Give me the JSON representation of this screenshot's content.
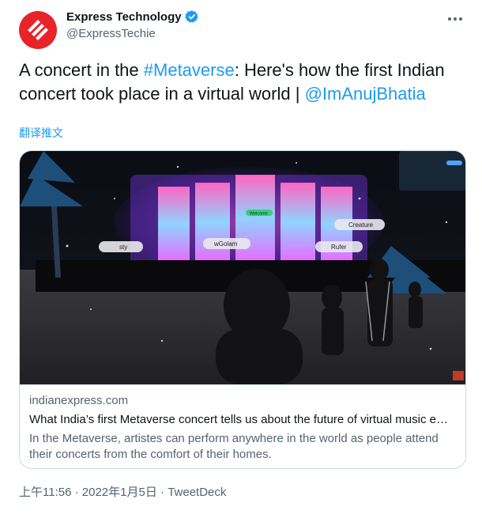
{
  "author": {
    "display_name": "Express Technology",
    "handle": "@ExpressTechie"
  },
  "tweet": {
    "text_prefix": "A concert in the ",
    "hashtag": "#Metaverse",
    "text_middle": ":  Here's how the first Indian concert took place in a virtual world | ",
    "mention": "@ImAnujBhatia",
    "translate_label": "翻译推文"
  },
  "card": {
    "domain": "indianexpress.com",
    "title": "What India’s first Metaverse concert tells us about the future of virtual music e…",
    "description": "In the Metaverse, artistes can perform anywhere in the world as people attend their concerts from the comfort of their homes.",
    "image_labels": {
      "stage_left": "sty",
      "stage_center": "wGolam",
      "stage_right": "Rufer",
      "right_tag": "Creature",
      "top_sign": "Welcome"
    }
  },
  "meta": {
    "time": "上午11:56",
    "separator1": " · ",
    "date": "2022年1月5日",
    "separator2": " · ",
    "source": "TweetDeck"
  },
  "colors": {
    "brand_red": "#e8232a",
    "link_blue": "#1d9bf0",
    "muted_gray": "#536471"
  }
}
